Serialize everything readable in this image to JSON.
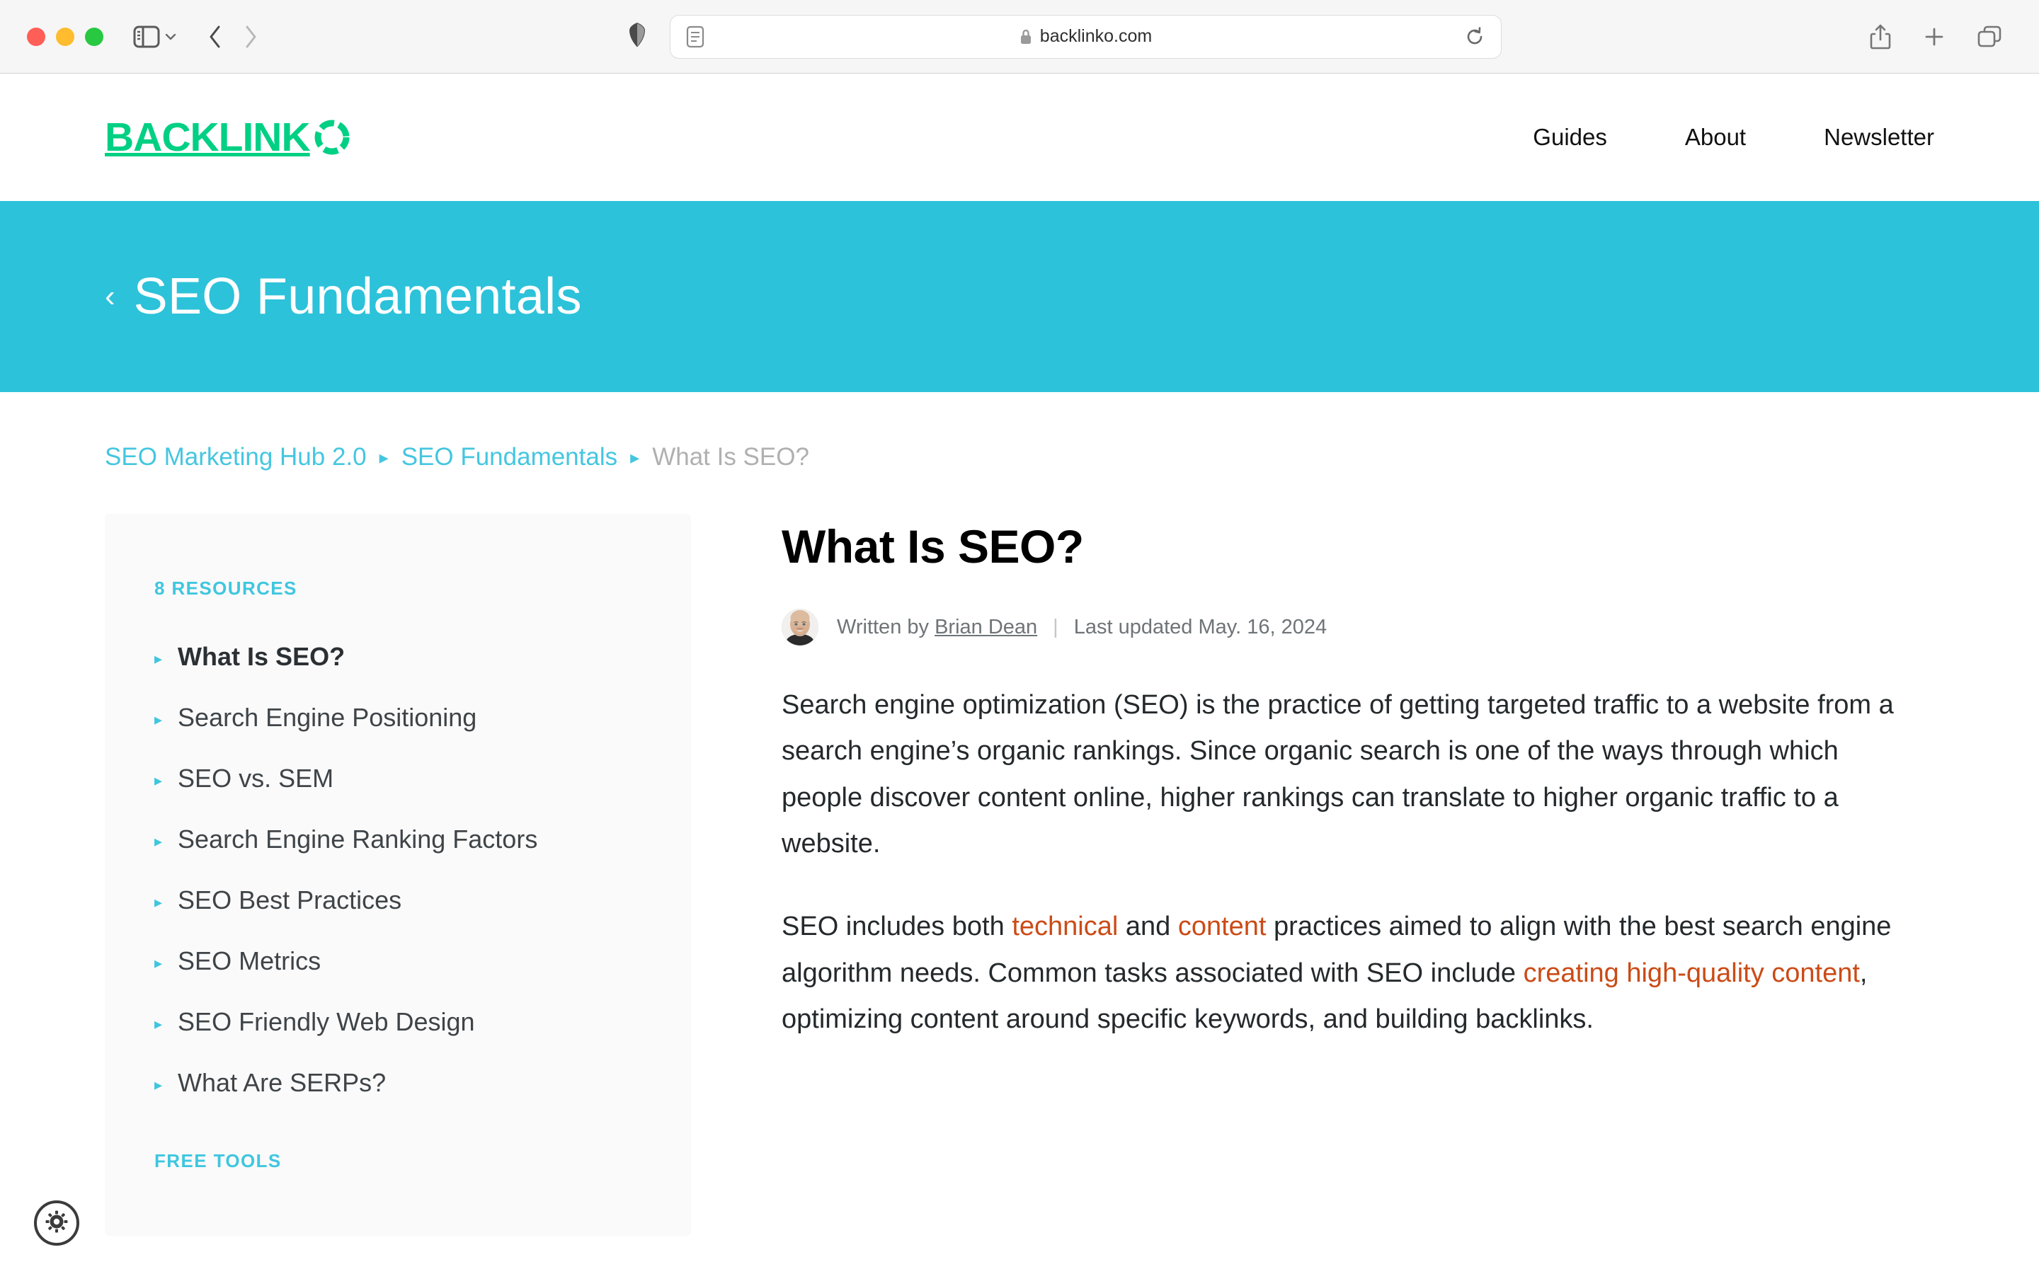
{
  "browser": {
    "url": "backlinko.com",
    "icons": {
      "sidebar_toggle": "sidebar-toggle-icon",
      "tab_group_chevron": "chevron-down-icon",
      "back": "back-arrow-icon",
      "forward": "forward-arrow-icon",
      "shield": "privacy-shield-icon",
      "reader": "reader-view-icon",
      "lock": "lock-icon",
      "reload": "reload-icon",
      "share": "share-icon",
      "new_tab": "plus-icon",
      "tab_overview": "tab-overview-icon"
    },
    "traffic_lights": [
      "close",
      "minimize",
      "zoom"
    ]
  },
  "site_header": {
    "logo_text": "BACKLINK",
    "logo_mark": "dashed-circle-o",
    "logo_color": "#00d084",
    "nav": [
      {
        "label": "Guides"
      },
      {
        "label": "About"
      },
      {
        "label": "Newsletter"
      }
    ]
  },
  "hero": {
    "back_glyph": "‹",
    "title": "SEO Fundamentals",
    "background_color": "#2cc2da"
  },
  "breadcrumb": {
    "items": [
      {
        "label": "SEO Marketing Hub 2.0",
        "current": false
      },
      {
        "label": "SEO Fundamentals",
        "current": false
      },
      {
        "label": "What Is SEO?",
        "current": true
      }
    ],
    "separator": "▸",
    "link_color": "#45c6e0",
    "current_color": "#b0b0b0"
  },
  "sidebar": {
    "resources_heading": "8 RESOURCES",
    "tools_heading": "FREE TOOLS",
    "accent_color": "#3fc6df",
    "bullet_glyph": "▸",
    "items": [
      {
        "label": "What Is SEO?",
        "active": true
      },
      {
        "label": "Search Engine Positioning",
        "active": false
      },
      {
        "label": "SEO vs. SEM",
        "active": false
      },
      {
        "label": "Search Engine Ranking Factors",
        "active": false
      },
      {
        "label": "SEO Best Practices",
        "active": false
      },
      {
        "label": "SEO Metrics",
        "active": false
      },
      {
        "label": "SEO Friendly Web Design",
        "active": false
      },
      {
        "label": "What Are SERPs?",
        "active": false
      }
    ]
  },
  "article": {
    "title": "What Is SEO?",
    "byline": {
      "written_by_label": "Written by",
      "author": "Brian Dean",
      "divider": "|",
      "last_updated": "Last updated May. 16, 2024"
    },
    "paragraph_1": "Search engine optimization (SEO) is the practice of getting targeted traffic to a website from a search engine’s organic rankings. Since organic search is one of the ways through which people discover content online, higher rankings can translate to higher organic traffic to a website.",
    "paragraph_2": {
      "part_1": "SEO includes both ",
      "link_1": "technical",
      "part_2": " and ",
      "link_2": "content",
      "part_3": " practices aimed to align with the best search engine algorithm needs. Common tasks associated with SEO include ",
      "link_3": "creating high-quality content",
      "part_4": ", optimizing content around specific keywords, and building backlinks."
    },
    "link_color": "#cb4b16"
  },
  "floating": {
    "gear_label": "settings-gear"
  }
}
